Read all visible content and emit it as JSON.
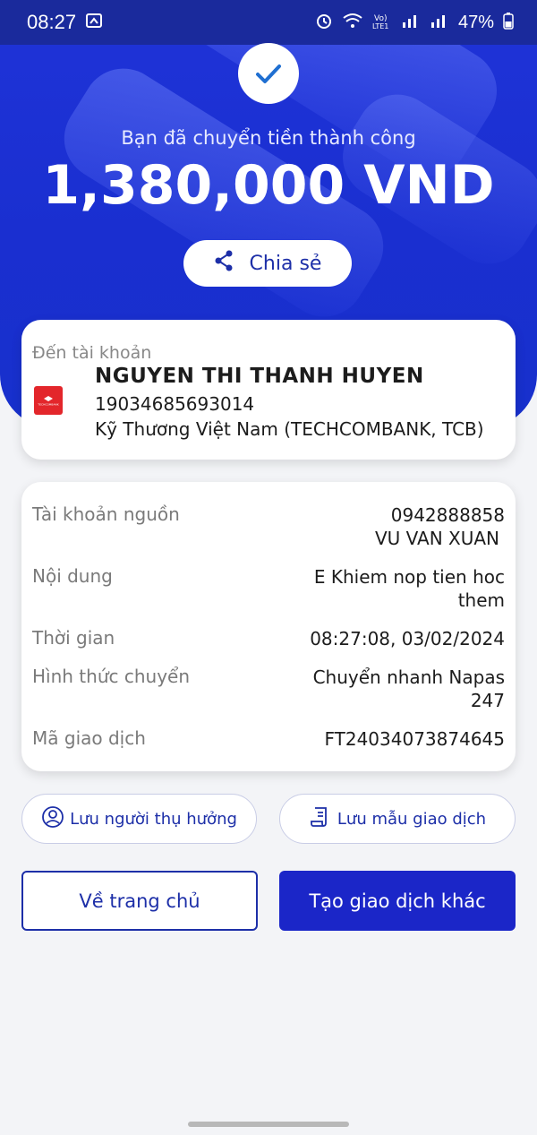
{
  "status_bar": {
    "time": "08:27",
    "battery": "47%"
  },
  "header": {
    "success_message": "Bạn đã chuyển tiền thành công",
    "amount": "1,380,000 VND",
    "share_label": "Chia sẻ"
  },
  "recipient": {
    "label": "Đến tài khoản",
    "name": "NGUYEN THI THANH HUYEN",
    "account_number": "19034685693014",
    "bank": "Kỹ Thương Việt Nam (TECHCOMBANK, TCB)",
    "logo_text": "TECHCOMBANK"
  },
  "details": {
    "source_label": "Tài khoản nguồn",
    "source_account": "0942888858",
    "source_name": "VU VAN XUAN",
    "content_label": "Nội dung",
    "content_line1": "E Khiem nop tien hoc",
    "content_line2": "them",
    "time_label": "Thời gian",
    "time_value": "08:27:08, 03/02/2024",
    "method_label": "Hình thức chuyển",
    "method_line1": "Chuyển nhanh Napas",
    "method_line2": "247",
    "txn_label": "Mã giao dịch",
    "txn_value": "FT24034073874645"
  },
  "actions": {
    "save_payee": "Lưu người thụ hưởng",
    "save_template": "Lưu mẫu giao dịch",
    "home": "Về trang chủ",
    "new_transaction": "Tạo giao dịch khác"
  },
  "colors": {
    "primary": "#1b26c8",
    "hero": "#1f33d8"
  }
}
